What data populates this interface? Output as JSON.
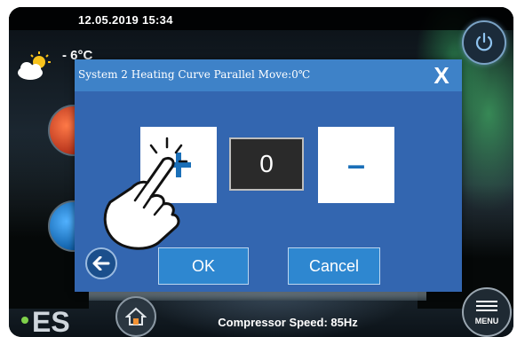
{
  "statusbar": {
    "datetime": "12.05.2019  15:34"
  },
  "weather": {
    "temperature": "- 6°C",
    "icon": "partly-cloudy-icon"
  },
  "dialog": {
    "title": "System 2 Heating Curve Parallel Move:0℃",
    "close_label": "X",
    "value": "0",
    "increment_icon": "plus-icon",
    "decrement_label": "–",
    "ok_label": "OK",
    "cancel_label": "Cancel",
    "back_icon": "back-arrow-icon"
  },
  "footer": {
    "compressor_text": "Compressor Speed: 85Hz",
    "menu_label": "MENU"
  },
  "colors": {
    "dialog_title_bg": "#3e82c8",
    "dialog_body_bg": "#3366b0",
    "button_bg": "#2e87d0",
    "accent_blue": "#1a6fb8"
  }
}
